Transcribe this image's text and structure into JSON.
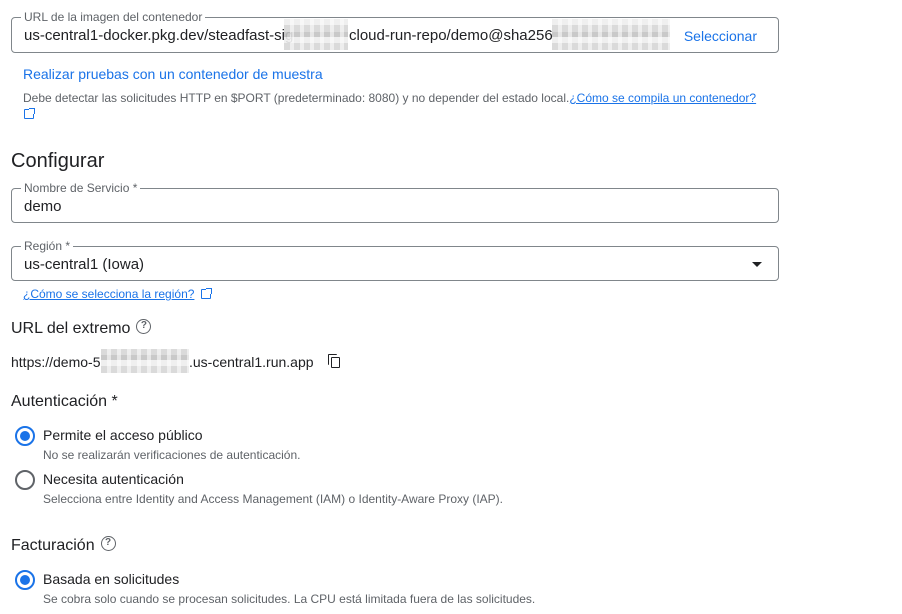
{
  "container_url": {
    "label": "URL de la imagen del contenedor",
    "value_start": "us-central1-docker.pkg.dev/steadfast-sig",
    "value_mid": "cloud-run-repo/demo@sha256",
    "select_label": "Seleccionar"
  },
  "sample_link": "Realizar pruebas con un contenedor de muestra",
  "sample_hint": {
    "text": "Debe detectar las solicitudes HTTP en $PORT (predeterminado: 8080) y no depender del estado local.",
    "link": "¿Cómo se compila un contenedor?"
  },
  "configure_heading": "Configurar",
  "service_name": {
    "label": "Nombre de Servicio *",
    "value": "demo"
  },
  "region": {
    "label": "Región *",
    "value": "us-central1 (Iowa)",
    "help_link": "¿Cómo se selecciona la región?"
  },
  "endpoint": {
    "heading": "URL del extremo",
    "url_start": "https://demo-5",
    "url_end": ".us-central1.run.app"
  },
  "auth": {
    "heading": "Autenticación *",
    "options": [
      {
        "label": "Permite el acceso público",
        "desc": "No se realizarán verificaciones de autenticación."
      },
      {
        "label": "Necesita autenticación",
        "desc": "Selecciona entre Identity and Access Management (IAM) o Identity-Aware Proxy (IAP)."
      }
    ]
  },
  "billing": {
    "heading": "Facturación",
    "options": [
      {
        "label": "Basada en solicitudes",
        "desc": "Se cobra solo cuando se procesan solicitudes. La CPU está limitada fuera de las solicitudes."
      }
    ]
  },
  "icons": {
    "help": "help-circle-icon",
    "copy": "copy-icon",
    "external": "external-link-icon",
    "dropdown": "dropdown-arrow-icon"
  },
  "colors": {
    "accent": "#1a73e8",
    "text": "#202124",
    "muted": "#5f6368",
    "border": "#80868b"
  }
}
